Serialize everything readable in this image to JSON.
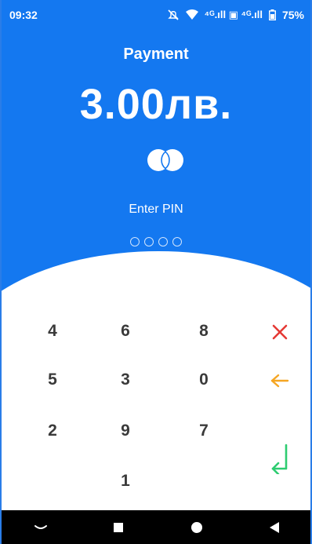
{
  "status_bar": {
    "time": "09:32",
    "signal_text": "⁴ᴳ.ıll ▣ ⁴ᴳ.ıll",
    "battery": "75%",
    "icons": [
      "mute-icon",
      "wifi-icon",
      "signal-icon",
      "battery-icon"
    ]
  },
  "header": {
    "title": "Payment",
    "amount": "3.00лв.",
    "card_brand_icon": "card-circles-icon"
  },
  "pin": {
    "prompt": "Enter PIN",
    "digits_total": 4,
    "digits_entered": 0
  },
  "keypad": {
    "keys": [
      "4",
      "6",
      "8",
      "5",
      "3",
      "0",
      "2",
      "9",
      "7",
      "1"
    ],
    "cancel_icon": "cancel-x-icon",
    "backspace_icon": "backspace-arrow-icon",
    "enter_icon": "enter-return-icon"
  },
  "nav_bar": {
    "icons": [
      "collapse-icon",
      "recents-square-icon",
      "home-circle-icon",
      "back-triangle-icon"
    ]
  },
  "colors": {
    "primary_blue": "#1478f0",
    "cancel_red": "#e53935",
    "backspace_orange": "#f5a623",
    "enter_green": "#2ecc71",
    "digit_text": "#3a3a3a"
  }
}
